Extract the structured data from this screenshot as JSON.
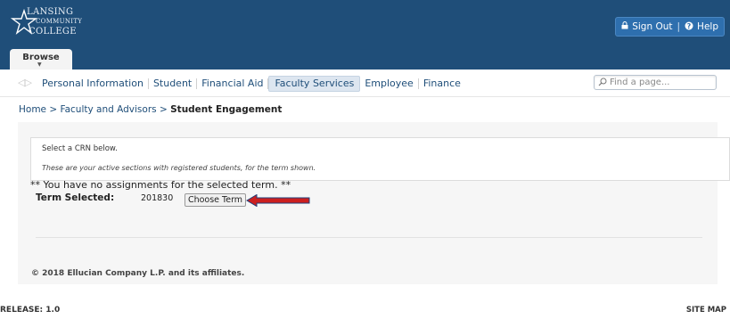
{
  "header": {
    "logo": {
      "line1": "LANSING",
      "line2": "COMMUNITY",
      "line3": "COLLEGE"
    },
    "sign_out_label": "Sign Out",
    "help_label": "Help",
    "separator": "|",
    "bg_color": "#1f4e79"
  },
  "browse_tab": {
    "label": "Browse"
  },
  "nav": {
    "items": [
      {
        "label": "Personal Information"
      },
      {
        "label": "Student"
      },
      {
        "label": "Financial Aid"
      },
      {
        "label": "Faculty Services",
        "active": true
      },
      {
        "label": "Employee"
      },
      {
        "label": "Finance"
      }
    ],
    "search_placeholder": "Find a page..."
  },
  "breadcrumb": {
    "home": "Home",
    "sep1": ">",
    "faculty": "Faculty and Advisors",
    "sep2": ">",
    "current": "Student Engagement"
  },
  "main": {
    "instruction": "Select a CRN below.",
    "note": "These are your active sections with registered students, for the term shown.",
    "no_assignments": "** You have no assignments for the selected term. **",
    "term_label": "Term Selected:",
    "term_value": "201830",
    "choose_term_label": "Choose Term",
    "arrow_color": "#cc1f1f"
  },
  "footer": {
    "copyright": "© 2018 Ellucian Company L.P. and its affiliates.",
    "release": "RELEASE: 1.0",
    "site_map": "SITE MAP"
  }
}
